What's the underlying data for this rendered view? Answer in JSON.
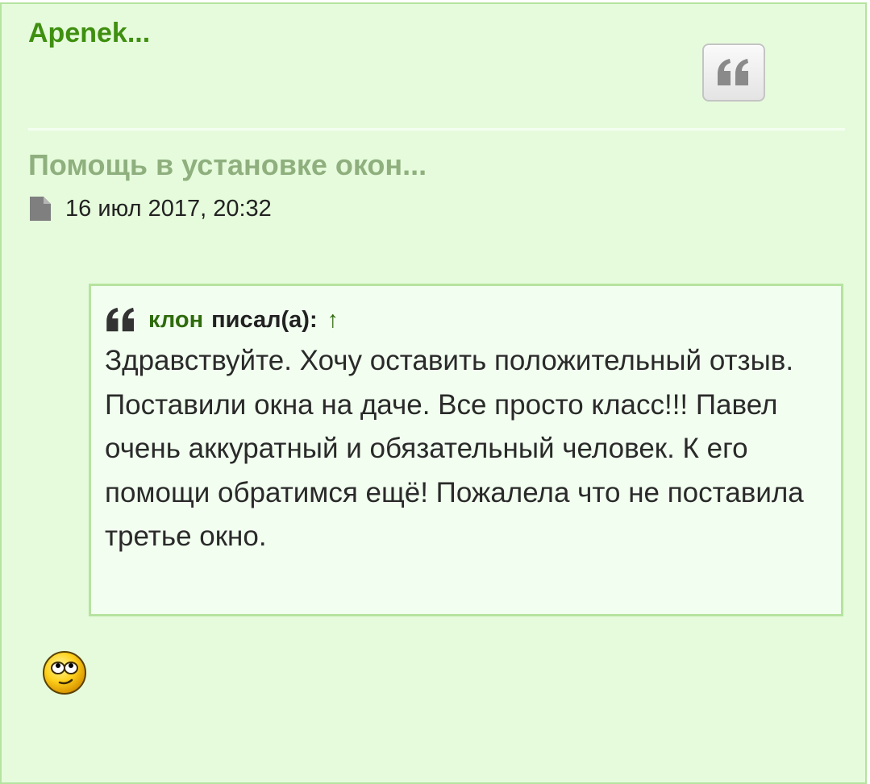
{
  "post": {
    "author": "Apenek...",
    "title": "Помощь в установке окон...",
    "date": "16 июл 2017, 20:32",
    "quote_button_icon": "quote-icon",
    "post_icon": "file-icon"
  },
  "blockquote": {
    "author": "клон",
    "wrote": "писал(а):",
    "jump": "↑",
    "text": "Здравствуйте. Хочу оставить положительный отзыв. Поставили окна на даче. Все просто класс!!! Павел очень аккуратный и обязательный человек. К его помощи обратимся ещё! Пожалела что не поставила третье окно."
  },
  "content": {
    "smiley_icon": "rolling-eyes-smiley-icon"
  },
  "colors": {
    "post_background": "#e6fbdc",
    "border": "#b5e3a0",
    "author": "#3f8f10",
    "title": "#8fb07e",
    "quote_background": "#f2fff0"
  }
}
